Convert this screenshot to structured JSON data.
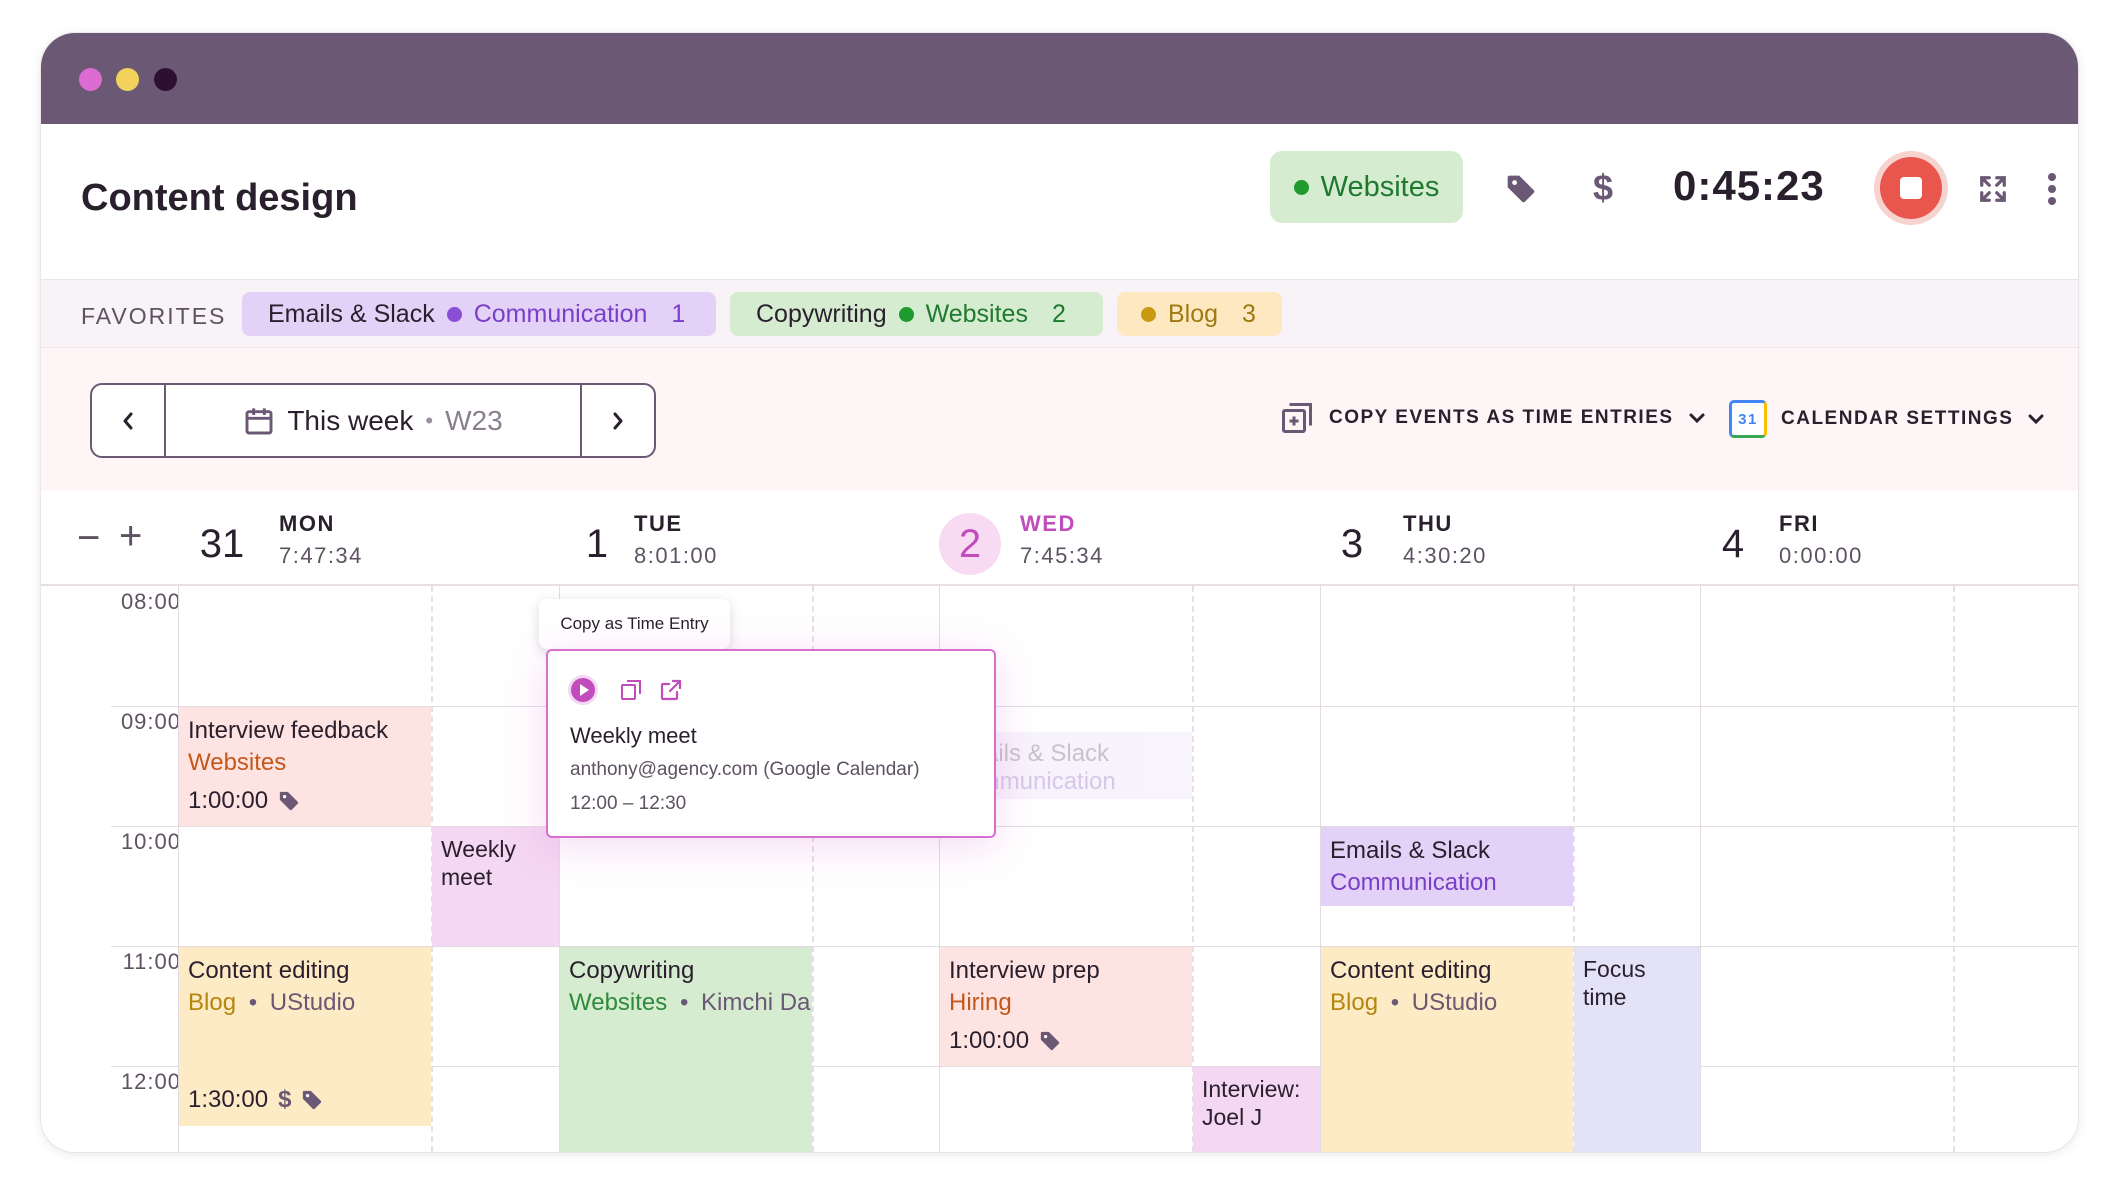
{
  "window": {
    "dots": [
      "#dc6bd2",
      "#f2d25d",
      "#2d0f33"
    ]
  },
  "header": {
    "title": "Content design",
    "project": {
      "label": "Websites",
      "color": "#1f9a2f"
    },
    "timer": "0:45:23",
    "icons": [
      "tag-icon",
      "dollar-icon",
      "expand-icon",
      "more-vertical-icon"
    ],
    "accent": "#e8564d"
  },
  "favorites": {
    "label": "FAVORITES",
    "items": [
      {
        "task": "Emails & Slack",
        "project": "Communication",
        "index": "1",
        "bg": "#e4d1f7",
        "dot": "#8b4fd6",
        "color": "#7a3fc8"
      },
      {
        "task": "Copywriting",
        "project": "Websites",
        "index": "2",
        "bg": "#d6ecd0",
        "dot": "#1f9a2f",
        "color": "#1f7a30"
      },
      {
        "task": "",
        "project": "Blog",
        "index": "3",
        "bg": "#fde8c2",
        "dot": "#c89a12",
        "color": "#a07a10"
      }
    ]
  },
  "toolbar": {
    "week_label": "This week",
    "week_code": "W23",
    "copy_events": "COPY EVENTS AS TIME ENTRIES",
    "calendar_settings": "CALENDAR SETTINGS",
    "calendar_icon_day": "31"
  },
  "days": [
    {
      "num": "31",
      "name": "MON",
      "total": "7:47:34"
    },
    {
      "num": "1",
      "name": "TUE",
      "total": "8:01:00"
    },
    {
      "num": "2",
      "name": "WED",
      "total": "7:45:34",
      "today": true
    },
    {
      "num": "3",
      "name": "THU",
      "total": "4:30:20"
    },
    {
      "num": "4",
      "name": "FRI",
      "total": "0:00:00"
    }
  ],
  "zoom": {
    "minus": "−",
    "plus": "+"
  },
  "hours": [
    "08:00",
    "09:00",
    "10:00",
    "11:00",
    "12:00"
  ],
  "events": {
    "mon_feedback": {
      "title": "Interview feedback",
      "project": "Websites",
      "duration": "1:00:00"
    },
    "mon_weekly": {
      "title": "Weekly meet"
    },
    "mon_content": {
      "title": "Content editing",
      "project": "Blog",
      "client": "UStudio",
      "duration": "1:30:00"
    },
    "tue_copy": {
      "title": "Copywriting",
      "project": "Websites",
      "client": "Kimchi Da"
    },
    "wed_ghost": {
      "title": "Emails & Slack",
      "project": "Communication"
    },
    "wed_prep": {
      "title": "Interview prep",
      "project": "Hiring",
      "duration": "1:00:00"
    },
    "wed_interview": {
      "title": "Interview: Joel J"
    },
    "thu_emails": {
      "title": "Emails & Slack",
      "project": "Communication"
    },
    "thu_content": {
      "title": "Content editing",
      "project": "Blog",
      "client": "UStudio"
    },
    "thu_focus": {
      "title": "Focus time"
    }
  },
  "popover": {
    "tooltip": "Copy as Time Entry",
    "title": "Weekly meet",
    "source": "anthony@agency.com (Google Calendar)",
    "time": "12:00 – 12:30",
    "icons": [
      "play-icon",
      "copy-icon",
      "external-link-icon"
    ]
  }
}
